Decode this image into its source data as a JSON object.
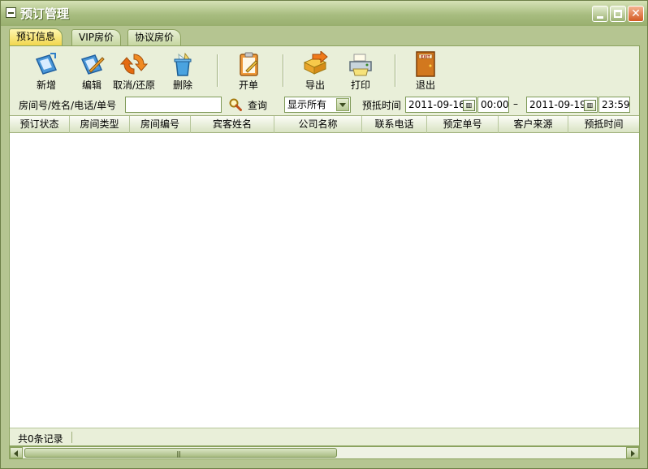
{
  "window": {
    "title": "预订管理"
  },
  "tabs": [
    {
      "label": "预订信息",
      "active": true
    },
    {
      "label": "VIP房价",
      "active": false
    },
    {
      "label": "协议房价",
      "active": false
    }
  ],
  "toolbar": {
    "add": "新增",
    "edit": "编辑",
    "cancel_restore": "取消/还原",
    "delete": "删除",
    "open_order": "开单",
    "export": "导出",
    "print": "打印",
    "exit": "退出"
  },
  "filter": {
    "search_label": "房间号/姓名/电话/单号",
    "search_value": "",
    "search_button": "查询",
    "display_select": "显示所有",
    "arrival_label": "预抵时间",
    "start_date": "2011-09-16",
    "start_time": "00:00",
    "range_dash": "–",
    "end_date": "2011-09-19",
    "end_time": "23:59"
  },
  "table": {
    "columns": [
      "预订状态",
      "房间类型",
      "房间编号",
      "宾客姓名",
      "公司名称",
      "联系电话",
      "预定单号",
      "客户来源",
      "预抵时间"
    ],
    "rows": []
  },
  "status": {
    "record_count": "共0条记录"
  },
  "colors": {
    "theme": "#b5c591",
    "tab_active": "#f1d64e",
    "close_button": "#d45a23"
  }
}
